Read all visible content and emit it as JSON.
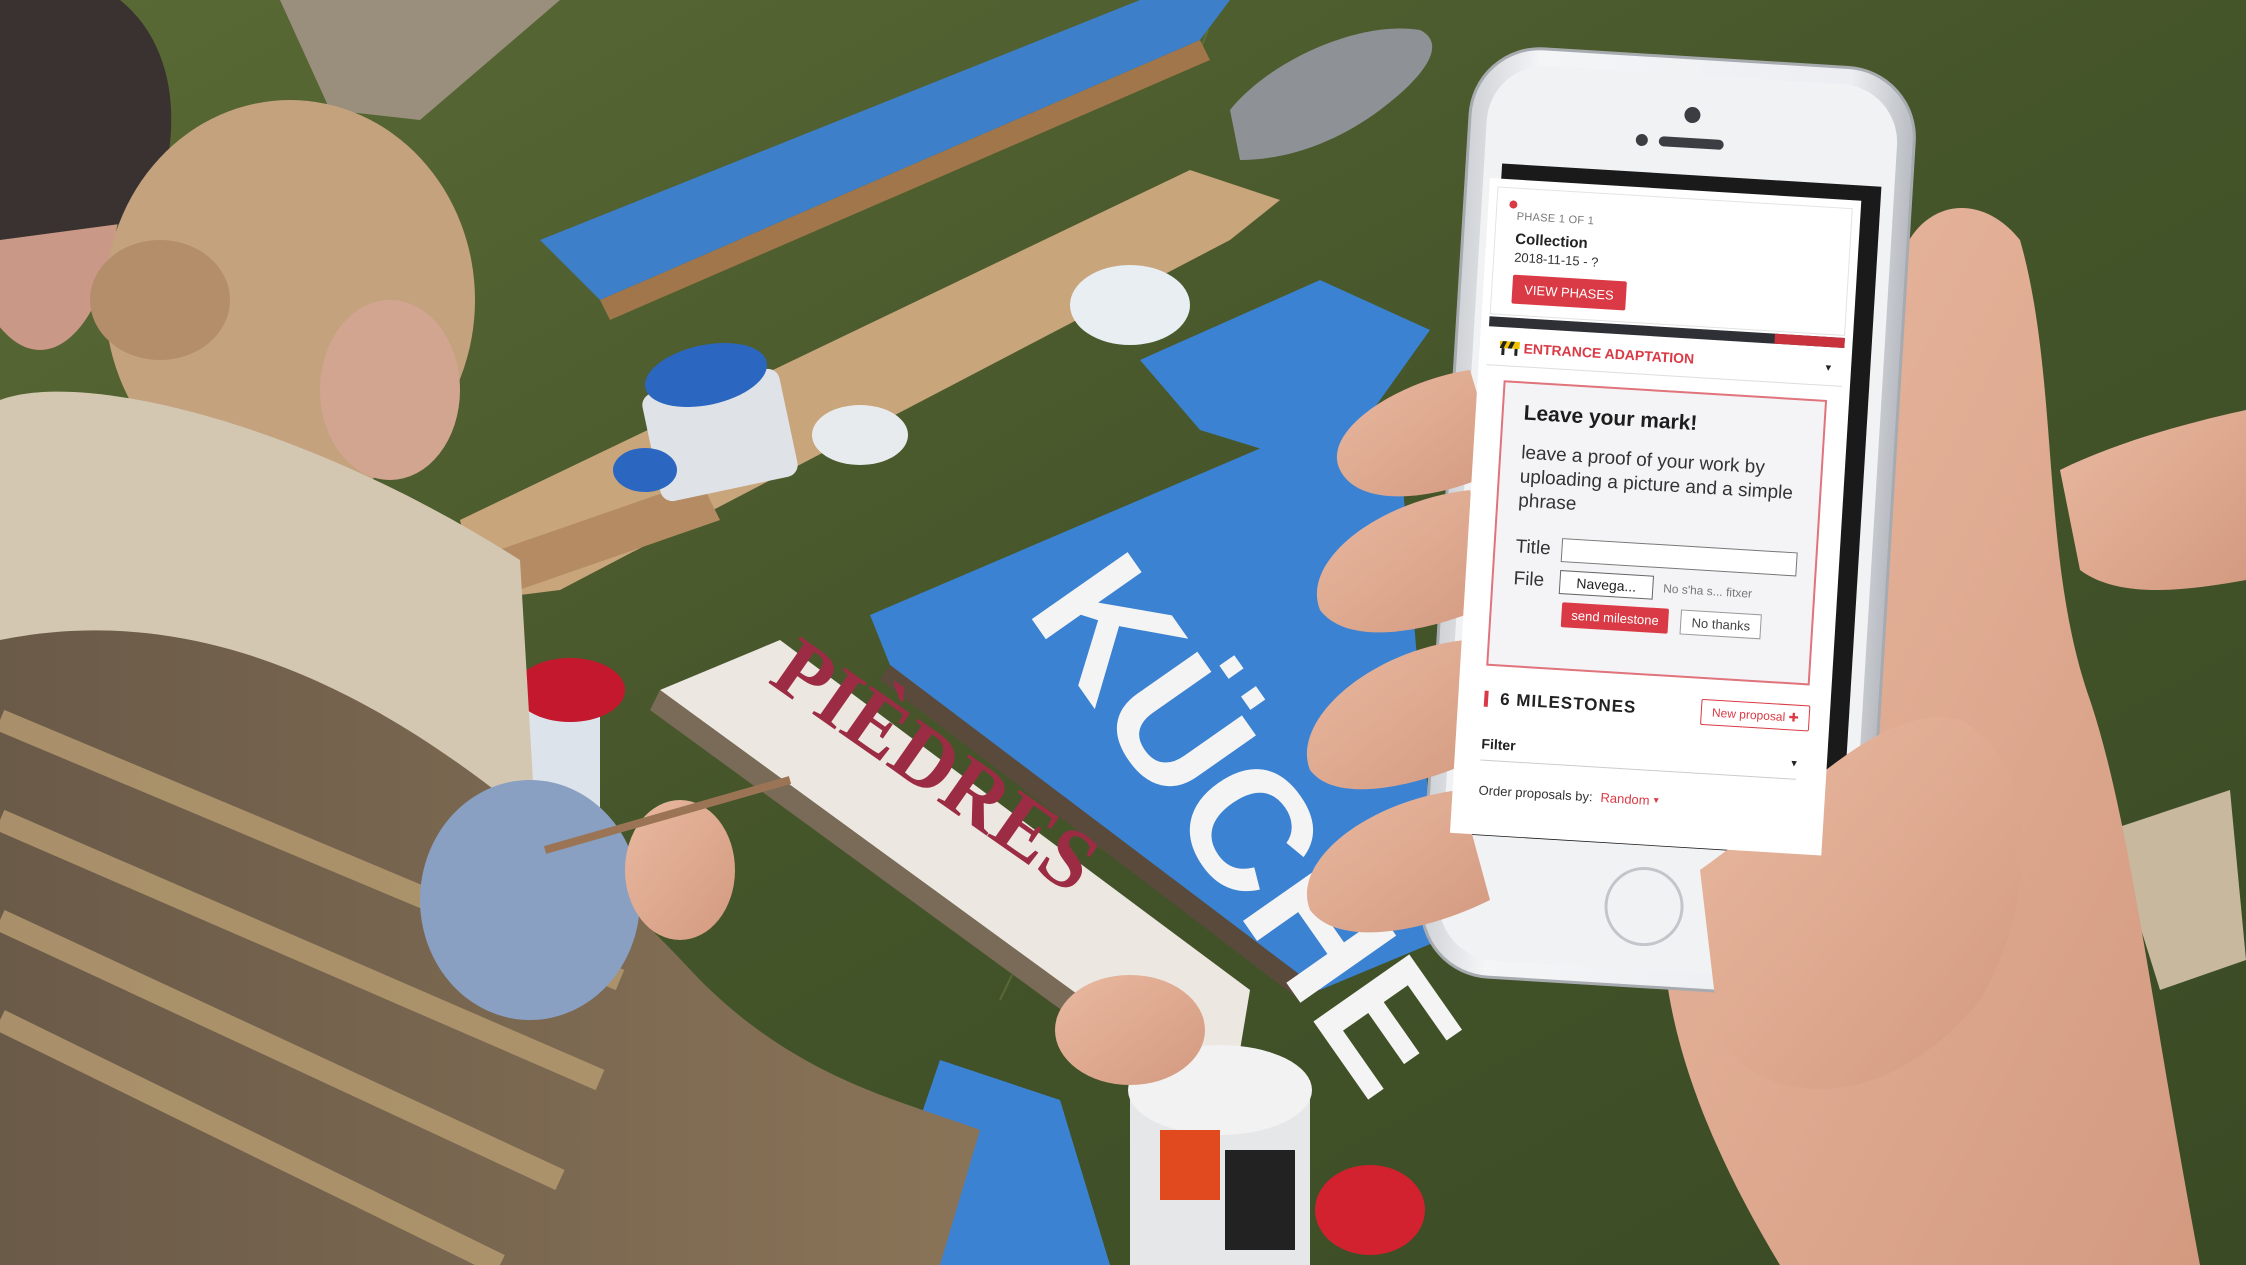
{
  "phase": {
    "label": "PHASE 1 OF 1",
    "name": "Collection",
    "date": "2018-11-15 - ?",
    "button": "VIEW PHASES"
  },
  "project": {
    "title": "ENTRANCE ADAPTATION",
    "icon": "construction-icon",
    "chevron": "▾"
  },
  "card": {
    "title": "Leave your mark!",
    "description": "leave a proof of your work by uploading a picture and a simple phrase",
    "title_label": "Title",
    "title_value": "",
    "file_label": "File",
    "file_button": "Navega...",
    "file_status": "No s'ha s... fitxer",
    "send_button": "send milestone",
    "cancel_button": "No thanks"
  },
  "milestones": {
    "count_label": "6 MILESTONES",
    "new_proposal": "New proposal ✚"
  },
  "filter": {
    "label": "Filter",
    "chevron": "▾"
  },
  "order": {
    "label": "Order proposals by:",
    "value": "Random",
    "chevron": "▾"
  },
  "colors": {
    "accent": "#d93a45",
    "phase_bar": "#2f3036",
    "card_border": "#e0737b"
  }
}
